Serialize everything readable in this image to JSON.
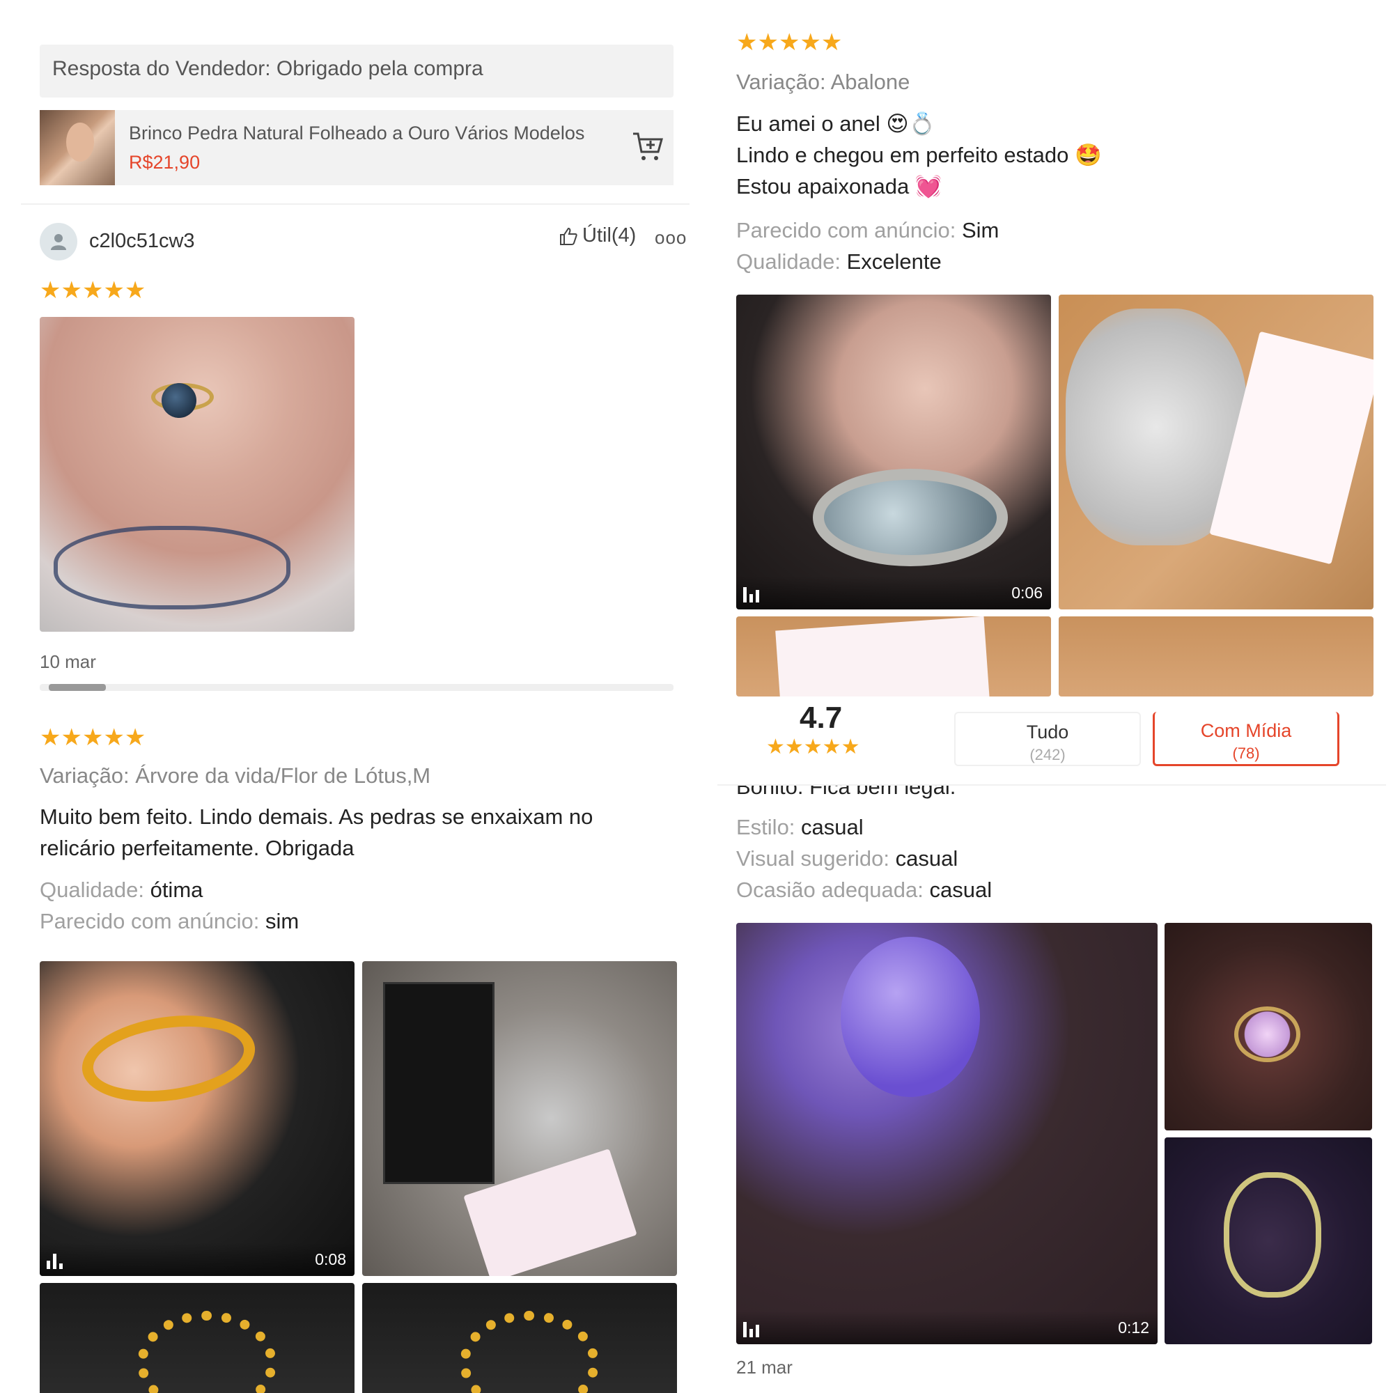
{
  "top_left": {
    "seller_reply": "Resposta do Vendedor: Obrigado pela compra",
    "product": {
      "name": "Brinco Pedra Natural Folheado a Ouro Vários Modelos",
      "price": "R$21,90",
      "cart_icon": "cart-add-icon"
    },
    "review": {
      "username": "c2l0c51cw3",
      "helpful_label": "Útil(4)",
      "more_label": "ooo",
      "stars": "★★★★★",
      "date": "10 mar"
    }
  },
  "bottom_left": {
    "stars": "★★★★★",
    "variation": "Variação: Árvore da vida/Flor de Lótus,M",
    "text_line1": "Muito bem feito. Lindo demais. As pedras se enxaixam no",
    "text_line2": "relicário perfeitamente.  Obrigada",
    "attrs": [
      {
        "key": "Qualidade:",
        "value": "ótima"
      },
      {
        "key": "Parecido com anúncio:",
        "value": "sim"
      }
    ],
    "video_time": "0:08"
  },
  "top_right": {
    "stars": "★★★★★",
    "variation": "Variação: Abalone",
    "text_lines": [
      "Eu amei o anel 😍💍",
      "Lindo e chegou em perfeito estado 🤩",
      "Estou apaixonada 💓"
    ],
    "attrs": [
      {
        "key": "Parecido com anúncio:",
        "value": "Sim"
      },
      {
        "key": "Qualidade:",
        "value": "Excelente"
      }
    ],
    "video_time": "0:06"
  },
  "bottom_right": {
    "summary": {
      "rating": "4.7",
      "stars": "★★★★★",
      "tab_all_label": "Tudo",
      "tab_all_count": "(242)",
      "tab_media_label": "Com Mídia",
      "tab_media_count": "(78)"
    },
    "cut_text": "Bonito. Fica bem legal.",
    "attrs": [
      {
        "key": "Estilo:",
        "value": "casual"
      },
      {
        "key": "Visual sugerido:",
        "value": "casual"
      },
      {
        "key": "Ocasião adequada:",
        "value": "casual"
      }
    ],
    "video_time": "0:12",
    "date": "21 mar"
  },
  "colors": {
    "accent": "#e5452a",
    "star": "#f7a81b"
  }
}
